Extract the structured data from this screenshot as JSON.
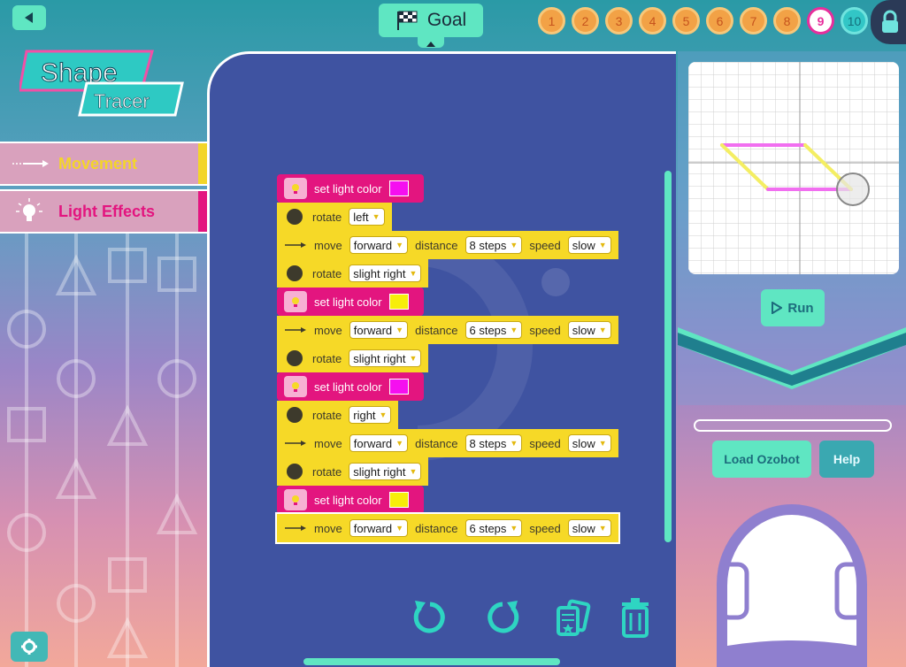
{
  "header": {
    "goal_label": "Goal",
    "levels": [
      "1",
      "2",
      "3",
      "4",
      "5",
      "6",
      "7",
      "8",
      "9",
      "10"
    ],
    "current_level": "9"
  },
  "logo": {
    "line1": "Shape",
    "line2": "Tracer"
  },
  "palette": {
    "items": [
      {
        "label": "Movement",
        "color": "#f3d52a"
      },
      {
        "label": "Light Effects",
        "color": "#e3157f"
      }
    ]
  },
  "program": {
    "blocks": [
      {
        "kind": "light",
        "label": "set light color",
        "color": "#f50ff0"
      },
      {
        "kind": "rotate",
        "label": "rotate",
        "value": "left"
      },
      {
        "kind": "move",
        "label": "move",
        "direction": "forward",
        "distance_label": "distance",
        "distance": "8 steps",
        "speed_label": "speed",
        "speed": "slow"
      },
      {
        "kind": "rotate",
        "label": "rotate",
        "value": "slight right"
      },
      {
        "kind": "light",
        "label": "set light color",
        "color": "#f7ee0a"
      },
      {
        "kind": "move",
        "label": "move",
        "direction": "forward",
        "distance_label": "distance",
        "distance": "6 steps",
        "speed_label": "speed",
        "speed": "slow"
      },
      {
        "kind": "rotate",
        "label": "rotate",
        "value": "slight right"
      },
      {
        "kind": "light",
        "label": "set light color",
        "color": "#f50ff0"
      },
      {
        "kind": "rotate",
        "label": "rotate",
        "value": "right"
      },
      {
        "kind": "move",
        "label": "move",
        "direction": "forward",
        "distance_label": "distance",
        "distance": "8 steps",
        "speed_label": "speed",
        "speed": "slow"
      },
      {
        "kind": "rotate",
        "label": "rotate",
        "value": "slight right"
      },
      {
        "kind": "light",
        "label": "set light color",
        "color": "#f7ee0a"
      },
      {
        "kind": "move",
        "label": "move",
        "direction": "forward",
        "distance_label": "distance",
        "distance": "6 steps",
        "speed_label": "speed",
        "speed": "slow"
      }
    ]
  },
  "preview": {
    "run_label": "Run",
    "trace_colors": [
      "#f16ff0",
      "#f4ee63"
    ]
  },
  "controls": {
    "load_label": "Load Ozobot",
    "help_label": "Help"
  },
  "icons": [
    "back-arrow-icon",
    "checkered-flag-icon",
    "lock-icon",
    "arrow-icon",
    "lightbulb-icon",
    "gear-icon",
    "undo-icon",
    "redo-icon",
    "cards-icon",
    "trash-icon",
    "play-icon"
  ],
  "colors": {
    "accent": "#5fe6c2",
    "workspace": "#3f53a1",
    "block_yellow": "#f6d927",
    "block_pink": "#e3157f"
  }
}
